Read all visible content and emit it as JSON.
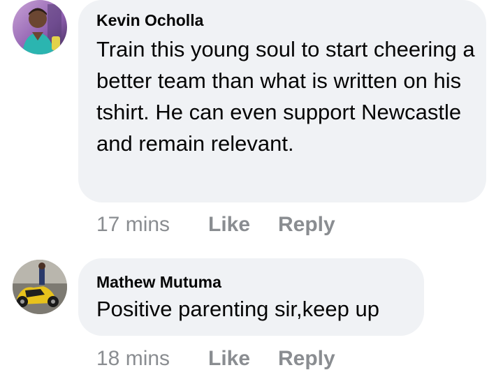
{
  "comments": [
    {
      "author": "Kevin Ocholla",
      "text": "Train this young soul to start cheering a better team than what is written on his tshirt. He can even support Newcastle and remain relevant.",
      "time": "17 mins",
      "like_label": "Like",
      "reply_label": "Reply"
    },
    {
      "author": "Mathew Mutuma",
      "text": "Positive parenting sir,keep up",
      "time": "18 mins",
      "like_label": "Like",
      "reply_label": "Reply"
    }
  ],
  "colors": {
    "bubble": "#f0f2f5",
    "text": "#050505",
    "meta": "#8a8d91"
  }
}
